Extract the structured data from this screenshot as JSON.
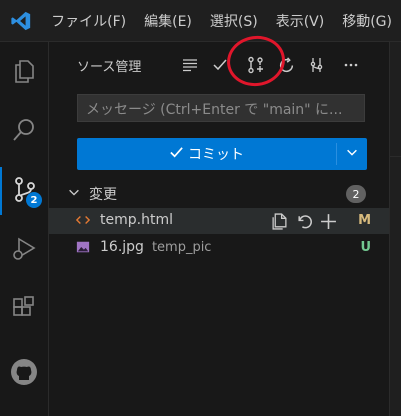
{
  "menu": [
    "ファイル(F)",
    "編集(E)",
    "選択(S)",
    "表示(V)",
    "移動(G)"
  ],
  "activity_bar": {
    "scm_badge": "2"
  },
  "scm": {
    "title": "ソース管理",
    "message_placeholder": "メッセージ (Ctrl+Enter で \"main\" に...",
    "commit_label": "コミット",
    "section_label": "変更",
    "section_count": "2",
    "files": [
      {
        "name": "temp.html",
        "dir": "",
        "status": "M",
        "status_color": "#d7ba7d"
      },
      {
        "name": "16.jpg",
        "dir": "temp_pic",
        "status": "U",
        "status_color": "#73c991"
      }
    ]
  },
  "colors": {
    "accent": "#0078d4",
    "annotation": "#e0162b"
  }
}
